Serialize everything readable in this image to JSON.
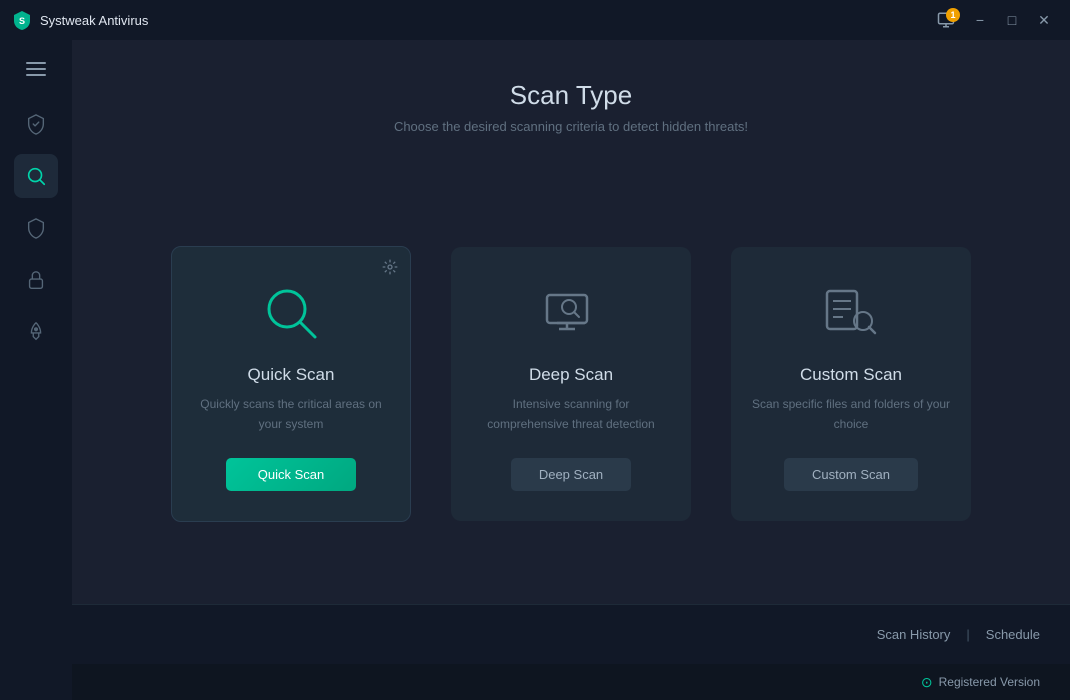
{
  "titleBar": {
    "appTitle": "Systweak Antivirus",
    "notificationCount": "1",
    "minimizeLabel": "−",
    "maximizeLabel": "□",
    "closeLabel": "✕"
  },
  "sidebar": {
    "items": [
      {
        "id": "protection",
        "icon": "shield",
        "label": "Protection",
        "active": false
      },
      {
        "id": "scan",
        "icon": "scan",
        "label": "Scan",
        "active": true
      },
      {
        "id": "security",
        "icon": "shield-check",
        "label": "Security",
        "active": false
      },
      {
        "id": "privacy",
        "icon": "privacy",
        "label": "Privacy",
        "active": false
      },
      {
        "id": "boost",
        "icon": "rocket",
        "label": "Boost",
        "active": false
      }
    ]
  },
  "header": {
    "title": "Scan Type",
    "subtitle": "Choose the desired scanning criteria to detect hidden threats!"
  },
  "cards": [
    {
      "id": "quick-scan",
      "title": "Quick Scan",
      "description": "Quickly scans the critical areas on your system",
      "buttonLabel": "Quick Scan",
      "buttonType": "primary",
      "hasSettings": true,
      "active": true
    },
    {
      "id": "deep-scan",
      "title": "Deep Scan",
      "description": "Intensive scanning for comprehensive threat detection",
      "buttonLabel": "Deep Scan",
      "buttonType": "secondary",
      "hasSettings": false,
      "active": false
    },
    {
      "id": "custom-scan",
      "title": "Custom Scan",
      "description": "Scan specific files and folders of your choice",
      "buttonLabel": "Custom Scan",
      "buttonType": "secondary",
      "hasSettings": false,
      "active": false
    }
  ],
  "footer": {
    "scanHistoryLabel": "Scan History",
    "divider": "|",
    "scheduleLabel": "Schedule"
  },
  "statusBar": {
    "registeredText": "Registered Version",
    "registeredIcon": "✓"
  }
}
